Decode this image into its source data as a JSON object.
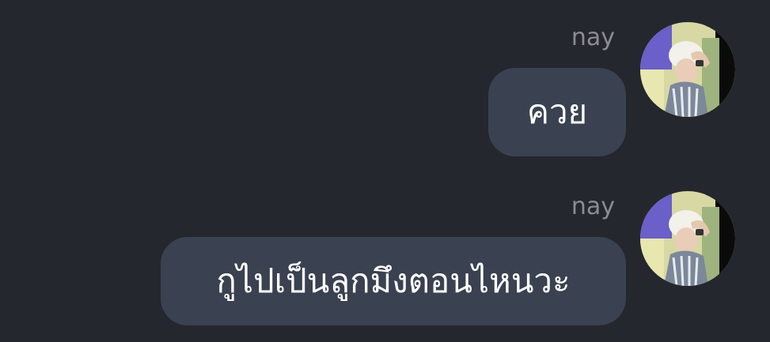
{
  "messages": [
    {
      "sender": "nay",
      "text": "ควย",
      "avatar_icon": "user-photo-avatar"
    },
    {
      "sender": "nay",
      "text": "กูไปเป็นลูกมึงตอนไหนวะ",
      "avatar_icon": "user-photo-avatar"
    }
  ],
  "colors": {
    "background": "#25272e",
    "bubble": "#3a4150",
    "sender_name": "#8a8c92",
    "message_text": "#ffffff"
  }
}
